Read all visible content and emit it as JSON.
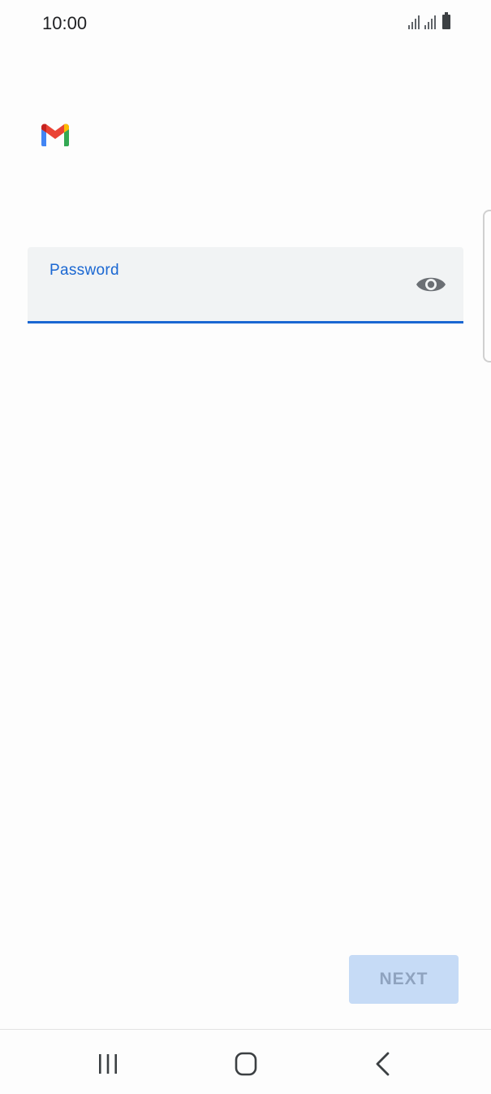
{
  "status_bar": {
    "time": "10:00",
    "icons": [
      "signal-icon",
      "signal-icon",
      "battery-icon"
    ]
  },
  "app": {
    "logo": "gmail-logo"
  },
  "password_field": {
    "label": "Password",
    "value": "",
    "visibility_toggle_icon": "eye-icon",
    "accent_color": "#1a67d2"
  },
  "actions": {
    "next_label": "NEXT"
  },
  "nav_bar": {
    "recents_icon": "recents-icon",
    "home_icon": "home-icon",
    "back_icon": "back-icon"
  }
}
